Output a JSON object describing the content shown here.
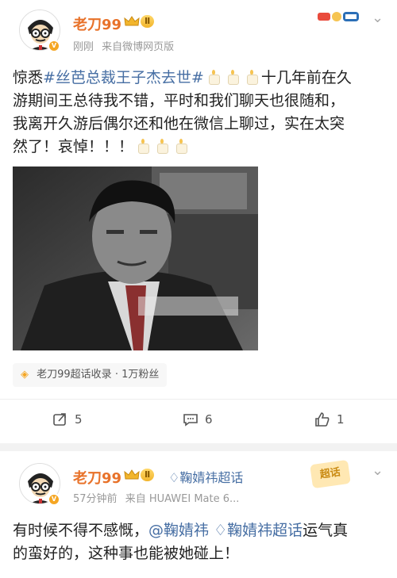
{
  "post1": {
    "author": "老刀99",
    "level": "Ⅱ",
    "time": "刚刚",
    "source": "来自微博网页版",
    "text_lead": "惊悉",
    "hashtag": "#丝芭总裁王子杰去世#",
    "text_line1": "十几年前在久",
    "text_line2": "游期间王总待我不错，平时和我们聊天也很随和，",
    "text_line3": "我离开久游后偶尔还和他在微信上聊过，实在太突",
    "text_line4": "然了！哀悼！！！",
    "collection": "老刀99超话收录 · 1万粉丝",
    "repost_count": "5",
    "comment_count": "6",
    "like_count": "1"
  },
  "post2": {
    "author": "老刀99",
    "level": "Ⅱ",
    "topic": "鞠婧祎超话",
    "time": "57分钟前",
    "source": "来自 HUAWEI Mate 6...",
    "sticker": "超话",
    "text_lead": "有时候不得不感慨，",
    "mention": "@鞠婧祎",
    "topic_inline": "鞠婧祎超话",
    "text_tail": "运气真",
    "text_line2": "的蛮好的，这种事也能被她碰上！"
  },
  "colors": {
    "username": "#e8722a",
    "link": "#466ea3",
    "accent": "#f5a623"
  }
}
